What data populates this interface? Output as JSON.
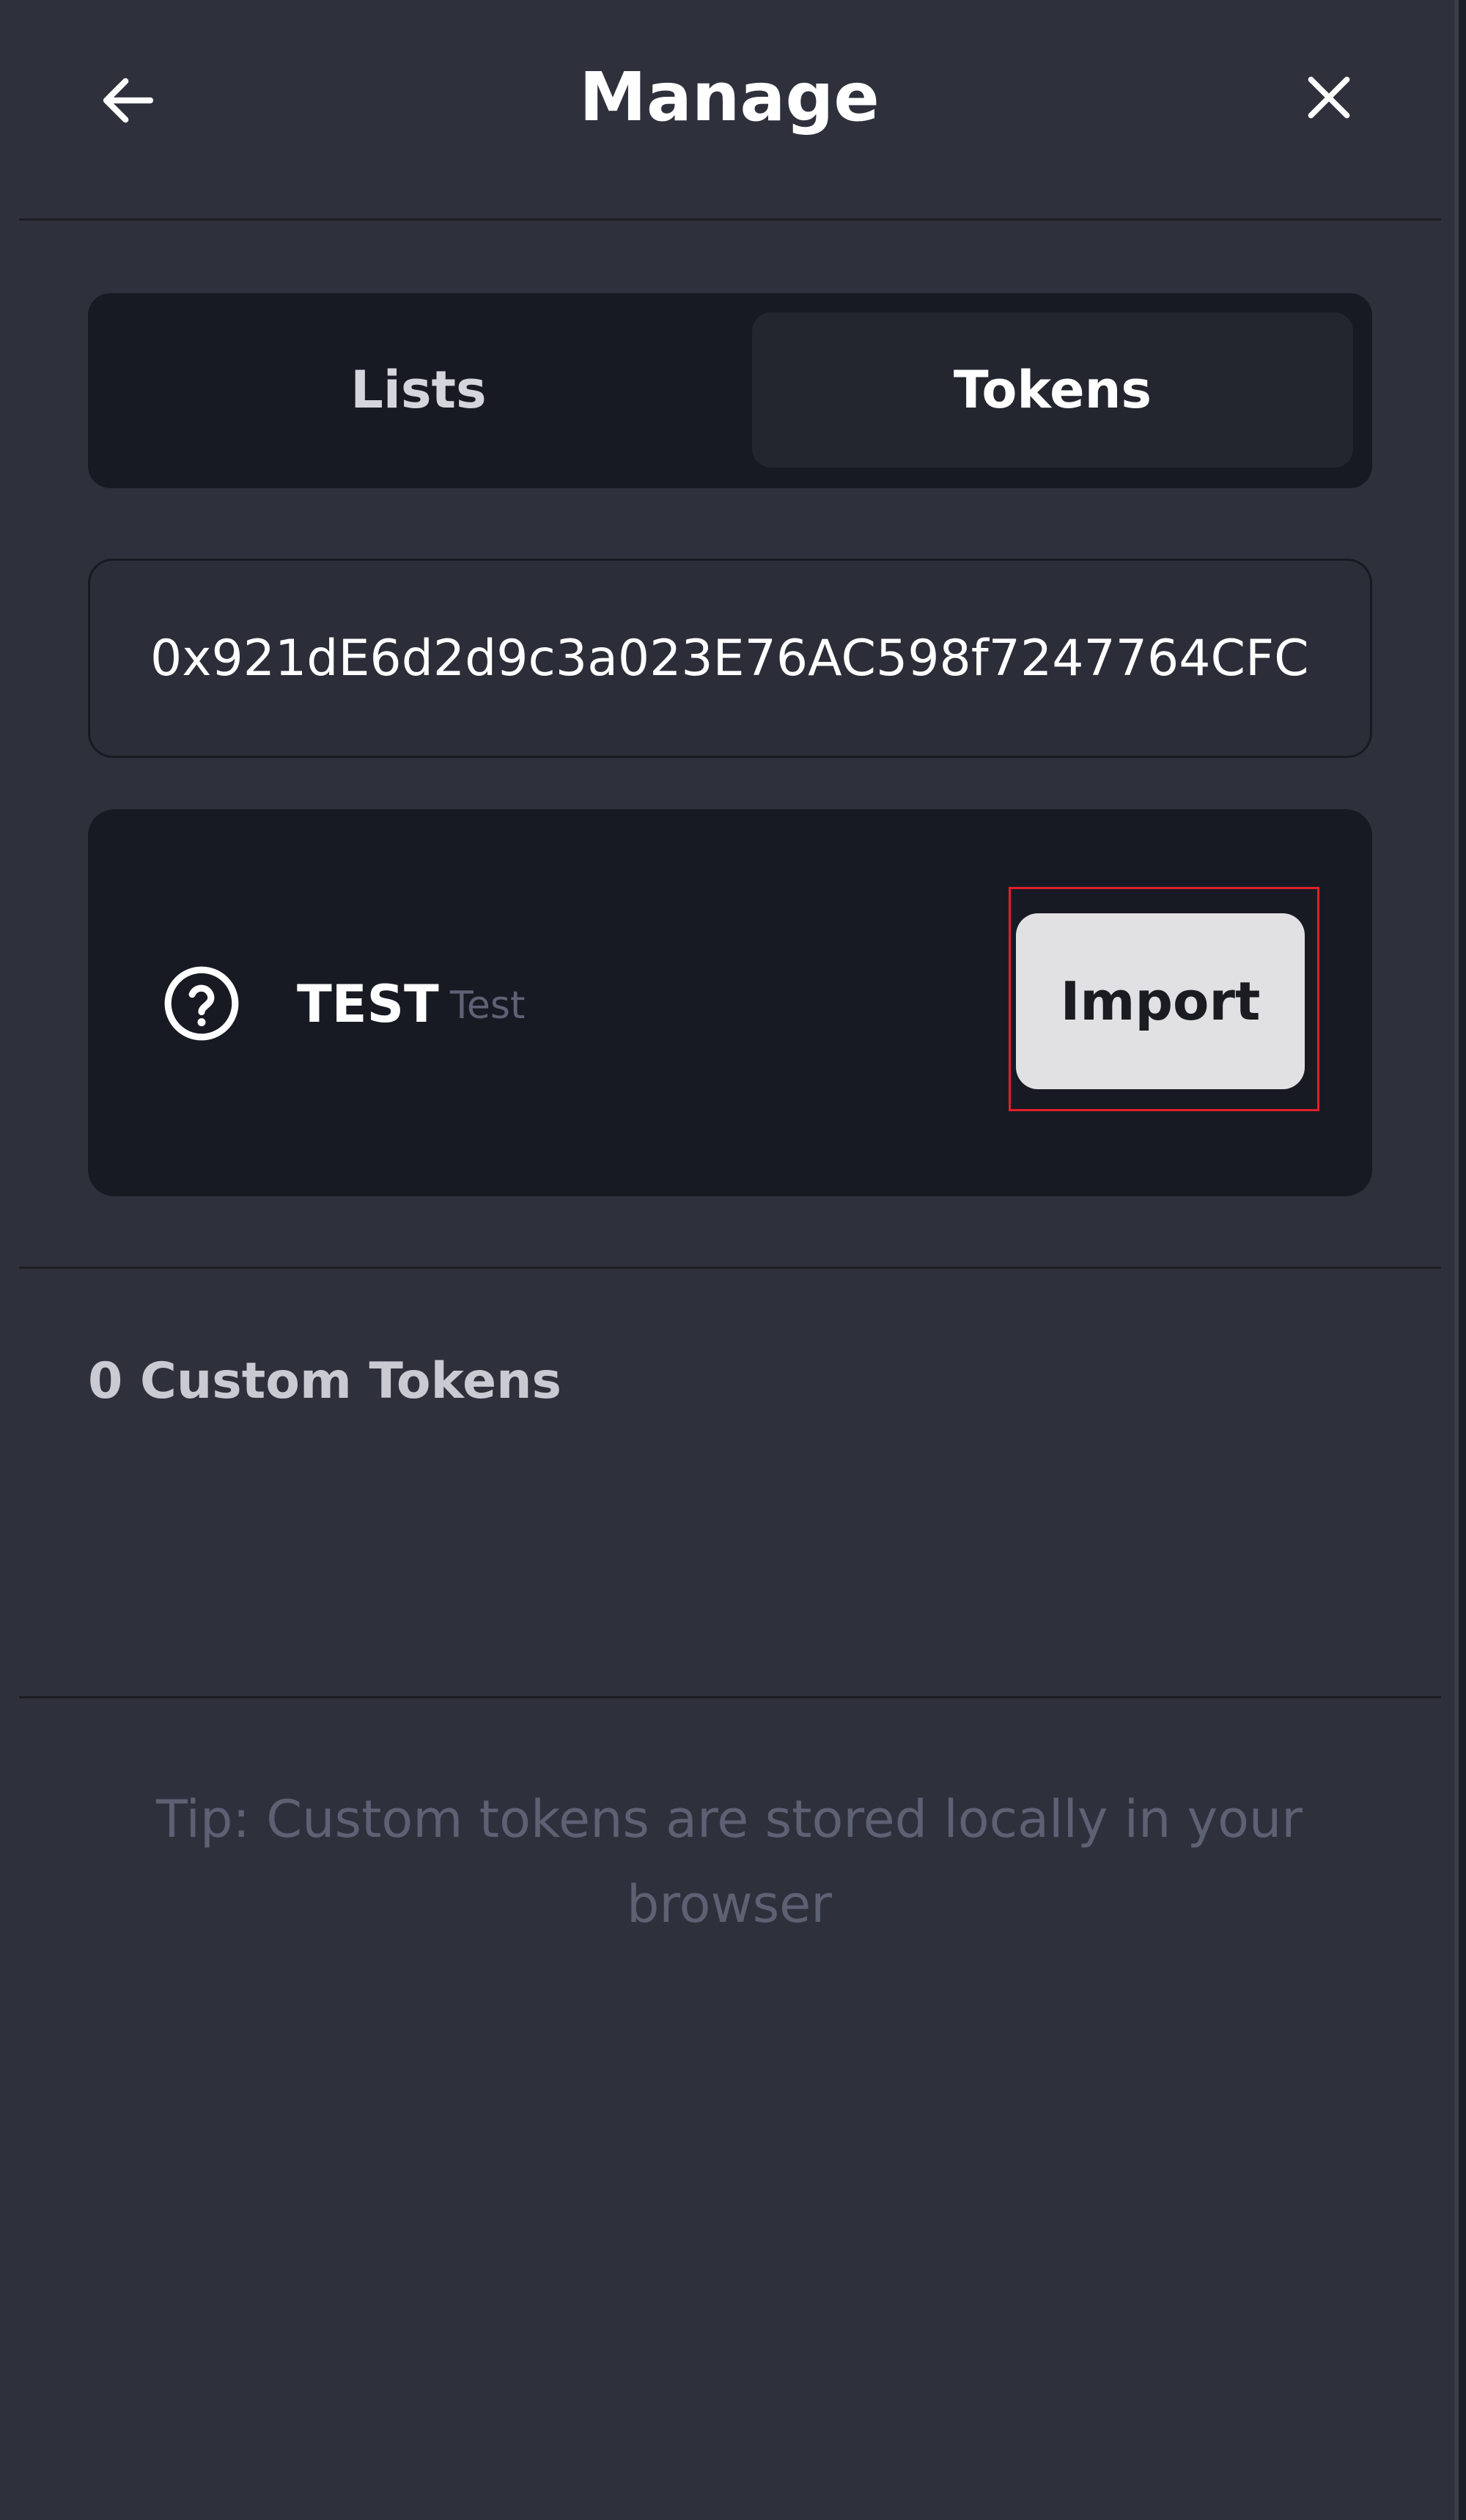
{
  "header": {
    "title": "Manage",
    "back_icon": "arrow-left-icon",
    "close_icon": "close-icon"
  },
  "tabs": [
    {
      "label": "Lists",
      "active": false
    },
    {
      "label": "Tokens",
      "active": true
    }
  ],
  "search": {
    "value": "0x921dE6d2d9c3a023E76AC598f7247764CFC"
  },
  "token_result": {
    "icon": "question-circle-icon",
    "symbol": "TEST",
    "name": "Test",
    "import_label": "Import"
  },
  "custom_tokens": {
    "count_label": "0 Custom Tokens"
  },
  "tip": "Tip: Custom tokens are stored locally in your browser",
  "colors": {
    "panel_bg": "#2e303c",
    "card_bg": "#181a23",
    "highlight": "#e0202a",
    "button_bg": "#e1e1e3"
  }
}
